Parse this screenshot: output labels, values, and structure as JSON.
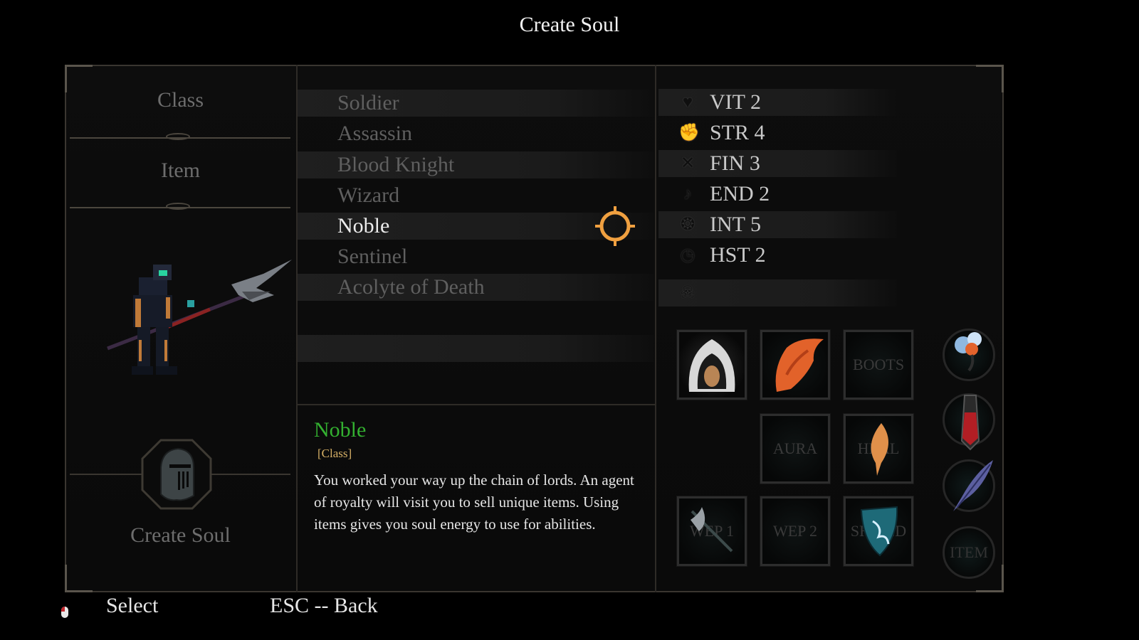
{
  "header": {
    "title": "Create Soul"
  },
  "sidebar": {
    "class_label": "Class",
    "item_label": "Item",
    "create_label": "Create Soul"
  },
  "classes": [
    {
      "label": "Soldier"
    },
    {
      "label": "Assassin"
    },
    {
      "label": "Blood Knight"
    },
    {
      "label": "Wizard"
    },
    {
      "label": "Noble"
    },
    {
      "label": "Sentinel"
    },
    {
      "label": "Acolyte of Death"
    }
  ],
  "selected_class": "Noble",
  "stats": [
    {
      "label": "VIT 2",
      "icon": "heart-icon"
    },
    {
      "label": "STR 4",
      "icon": "fist-icon"
    },
    {
      "label": "FIN 3",
      "icon": "crossed-blades-icon"
    },
    {
      "label": "END 2",
      "icon": "leg-icon"
    },
    {
      "label": "INT 5",
      "icon": "brain-icon"
    },
    {
      "label": "HST 2",
      "icon": "clock-icon"
    },
    {
      "label": "",
      "icon": "skull-icon"
    }
  ],
  "equipment": {
    "hood": "hood-item-icon",
    "cape": "cape-item-icon",
    "boots_label": "BOOTS",
    "aura_label": "AURA",
    "heal_label": "HEAL",
    "wep1_label": "WEP 1",
    "wep2_label": "WEP 2",
    "shield_label": "SHIELD",
    "item_label": "ITEM"
  },
  "description": {
    "name": "Noble",
    "type": "[Class]",
    "text": "You worked your way up the chain of lords. An agent of royalty will visit you to sell unique items. Using items gives you soul energy to use for abilities."
  },
  "footer": {
    "select_label": "Select",
    "back_label": "ESC -- Back"
  },
  "colors": {
    "selected_name": "#33b030",
    "class_tag": "#d6b066",
    "cursor": "#f0a040"
  }
}
